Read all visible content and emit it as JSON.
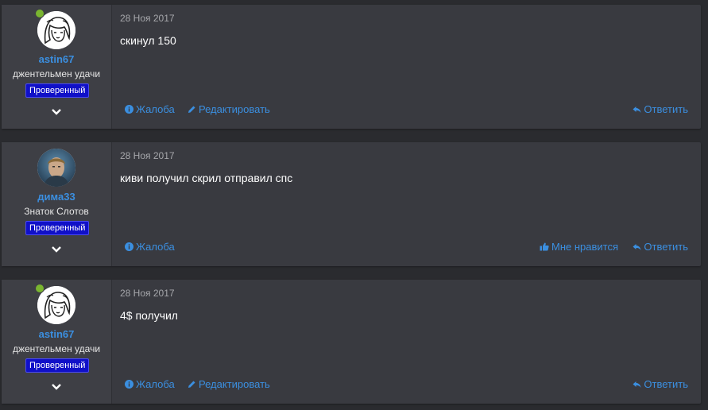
{
  "posts": [
    {
      "username": "astin67",
      "title": "джентельмен удачи",
      "badge": "Проверенный",
      "online": true,
      "avatar_icon": "cartoon-girl-avatar",
      "date": "28 Ноя 2017",
      "message": "скинул 150",
      "actions": {
        "report": "Жалоба",
        "edit": "Редактировать",
        "reply": "Ответить"
      }
    },
    {
      "username": "дима33",
      "title": "Знаток Слотов",
      "badge": "Проверенный",
      "online": false,
      "avatar_icon": "photo-avatar",
      "date": "28 Ноя 2017",
      "message": "киви получил скрил отправил спс",
      "actions": {
        "report": "Жалоба",
        "like": "Мне нравится",
        "reply": "Ответить"
      }
    },
    {
      "username": "astin67",
      "title": "джентельмен удачи",
      "badge": "Проверенный",
      "online": true,
      "avatar_icon": "cartoon-girl-avatar",
      "date": "28 Ноя 2017",
      "message": "4$ получил",
      "actions": {
        "report": "Жалоба",
        "edit": "Редактировать",
        "reply": "Ответить"
      }
    }
  ],
  "colors": {
    "link": "#3b8fe0",
    "badge_bg": "#1010c8",
    "online": "#7ab530",
    "post_bg": "#393a40"
  }
}
